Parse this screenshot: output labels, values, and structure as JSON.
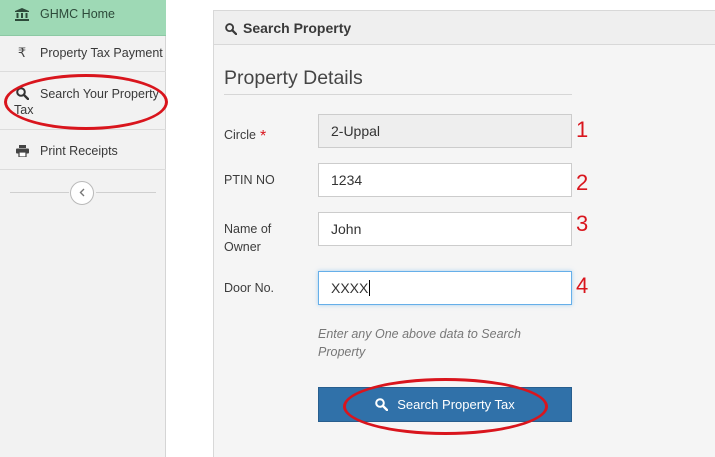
{
  "sidebar": {
    "items": [
      {
        "label": "GHMC Home",
        "icon": "bank-icon"
      },
      {
        "label": "Property Tax Payment",
        "icon": "rupee-icon",
        "icon_glyph": "₹"
      },
      {
        "label_line1": "Search Your Property",
        "label_line2": "Tax",
        "icon": "search-icon"
      },
      {
        "label": "Print Receipts",
        "icon": "print-icon"
      }
    ],
    "collapse_icon": "chevron-left-icon"
  },
  "panel": {
    "header_title": "Search Property",
    "section_title": "Property Details"
  },
  "form": {
    "circle_label": "Circle",
    "required_mark": "*",
    "circle_value": "2-Uppal",
    "ptin_label": "PTIN NO",
    "ptin_value": "1234",
    "owner_label_line1": "Name of",
    "owner_label_line2": "Owner",
    "owner_value": "John",
    "door_label": "Door No.",
    "door_value": "XXXX",
    "hint_line1": "Enter any One above data to Search",
    "hint_line2": "Property",
    "search_button": "Search Property Tax"
  },
  "annotations": [
    "1",
    "2",
    "3",
    "4"
  ],
  "colors": {
    "active_sidebar": "#9ed9b5",
    "primary_button": "#3071a9",
    "annotation_red": "#d9151d",
    "focus_border": "#66afe9"
  }
}
